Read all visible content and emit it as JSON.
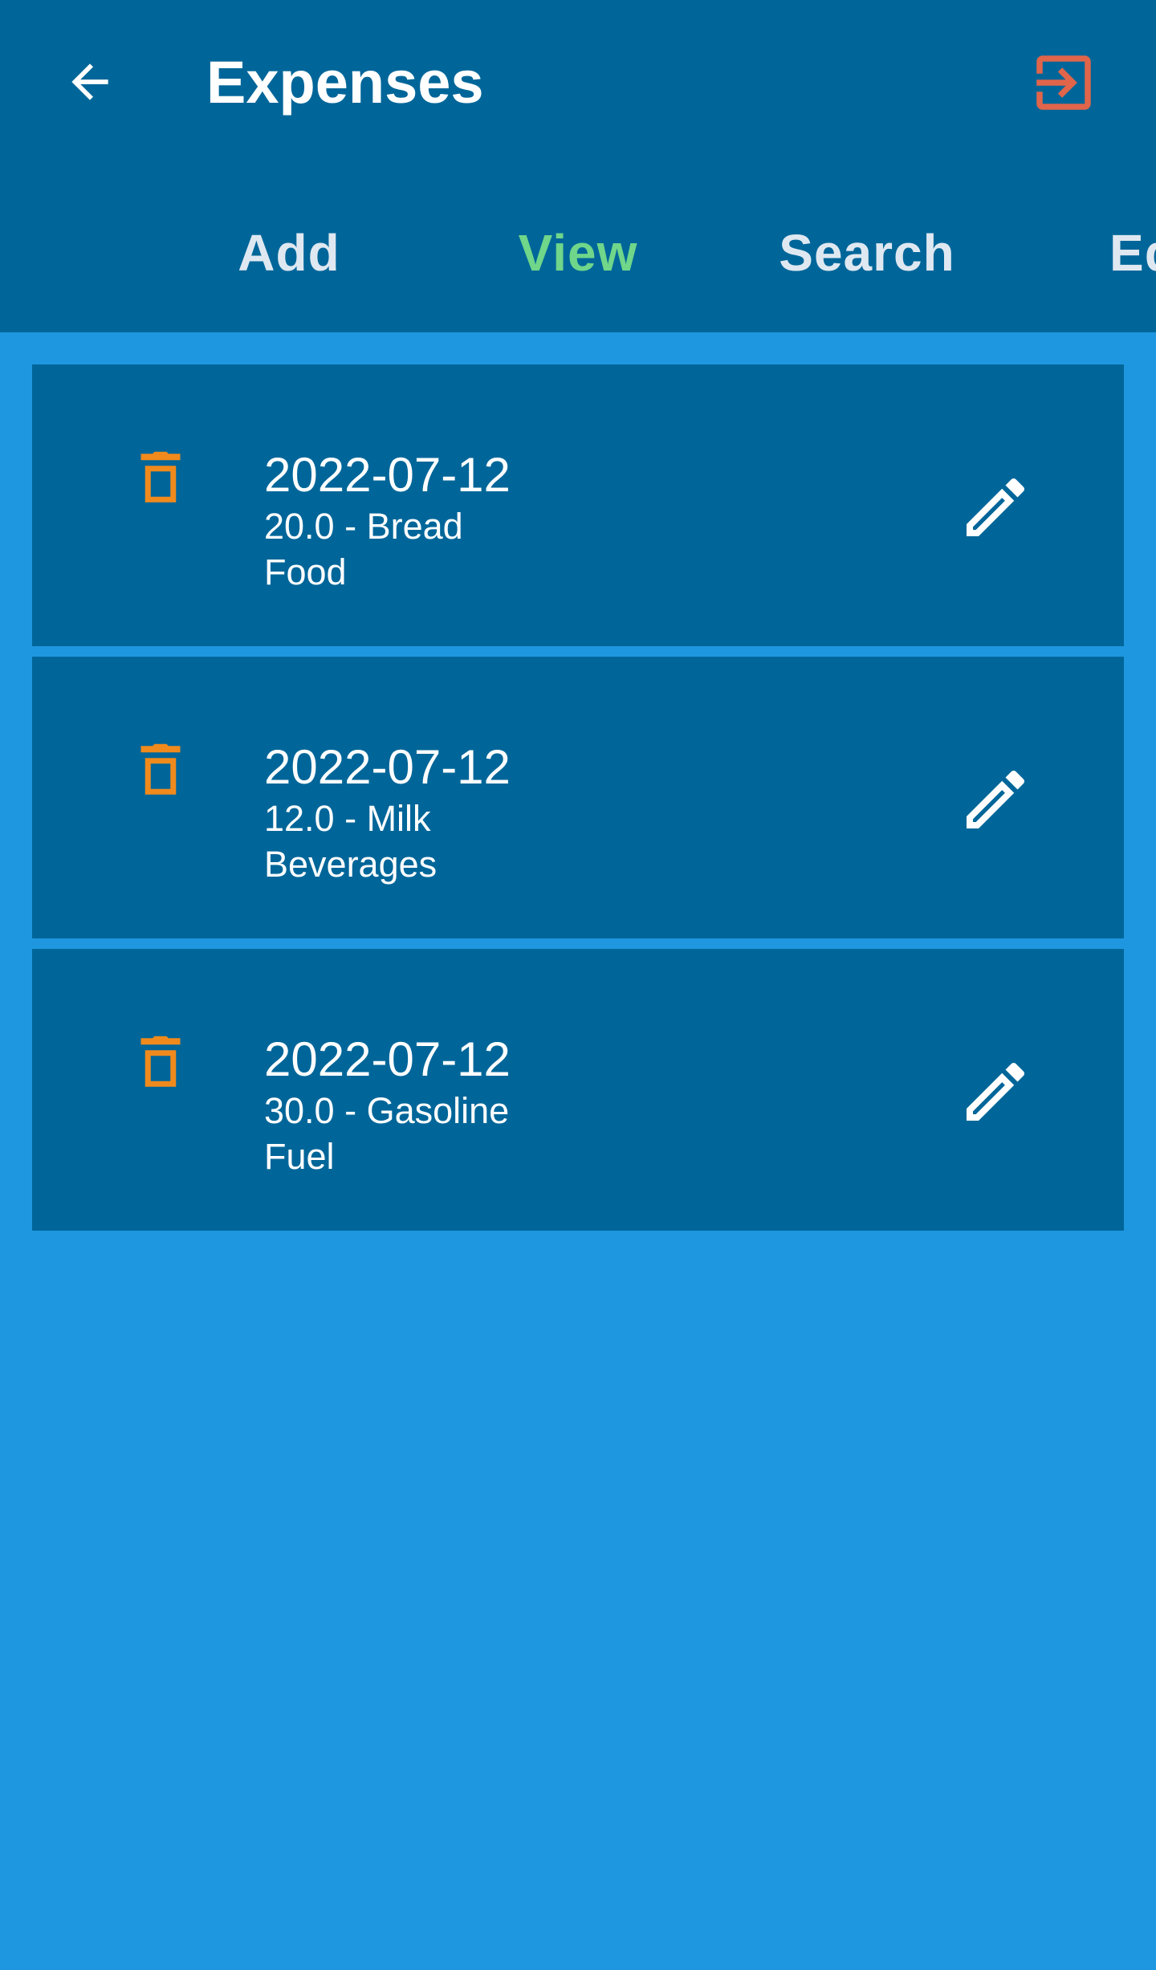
{
  "app": {
    "title": "Expenses"
  },
  "icons": {
    "back": "arrow-left-icon",
    "exit": "exit-to-app-icon",
    "delete": "trash-icon",
    "edit": "pencil-icon"
  },
  "colors": {
    "header_bg": "#006699",
    "page_bg": "#1e97e0",
    "active_tab": "#6fd68a",
    "exit_icon": "#e0654a",
    "trash_icon": "#f08a1c"
  },
  "tabs": [
    {
      "label": "Add",
      "active": false
    },
    {
      "label": "View",
      "active": true
    },
    {
      "label": "Search",
      "active": false
    },
    {
      "label": "Ed",
      "active": false
    }
  ],
  "expenses": [
    {
      "date": "2022-07-12",
      "amount_desc": "20.0 - Bread",
      "category": "Food"
    },
    {
      "date": "2022-07-12",
      "amount_desc": "12.0 - Milk",
      "category": "Beverages"
    },
    {
      "date": "2022-07-12",
      "amount_desc": "30.0 - Gasoline",
      "category": "Fuel"
    }
  ]
}
